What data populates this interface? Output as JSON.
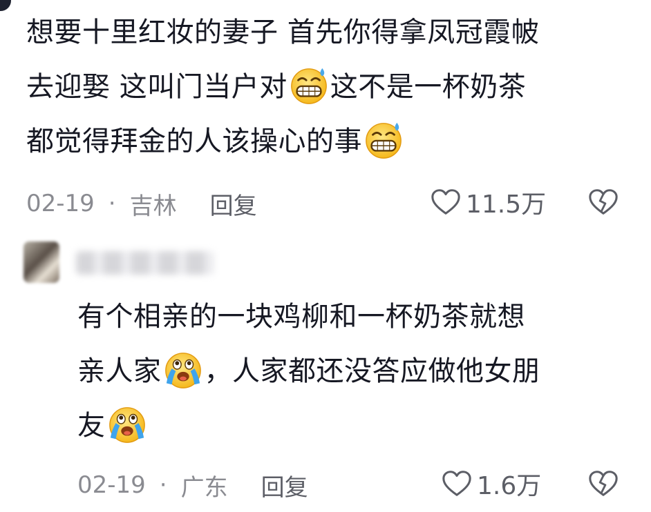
{
  "comments": [
    {
      "lines": [
        [
          "想要十里红妆的妻子 首先你得拿凤冠霞帔"
        ],
        [
          "去迎娶 这叫门当户对",
          "[grin-sweat]",
          "这不是一杯奶茶"
        ],
        [
          "都觉得拜金的人该操心的事",
          "[grin-sweat]"
        ]
      ],
      "line_1": "想要十里红妆的妻子 首先你得拿凤冠霞帔",
      "line_2a": "去迎娶 这叫门当户对",
      "line_2b": "这不是一杯奶茶",
      "line_3": "都觉得拜金的人该操心的事",
      "date": "02-19",
      "separator": "·",
      "location": "吉林",
      "reply_label": "回复",
      "likes": "11.5万"
    },
    {
      "line_1": "有个相亲的一块鸡柳和一杯奶茶就想",
      "line_2a": "亲人家",
      "line_2b": "，人家都还没答应做他女朋",
      "line_3": "友",
      "date": "02-19",
      "separator": "·",
      "location": "广东",
      "reply_label": "回复",
      "likes": "1.6万"
    }
  ],
  "icons": {
    "emoji_1": "grinning-sweat-emoji",
    "emoji_2": "crying-laughing-emoji",
    "like": "heart-outline-icon",
    "dislike": "broken-heart-icon"
  },
  "colors": {
    "text": "#161823",
    "meta": "#8a8b91",
    "reply": "#5c5e66"
  }
}
